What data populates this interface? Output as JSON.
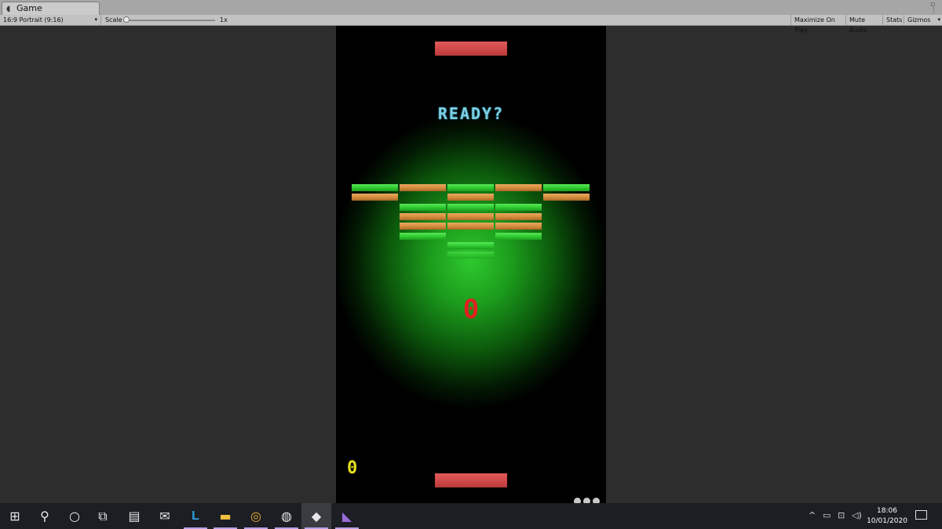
{
  "window": {
    "tab_title": "Game",
    "tab_icon": "unity-logo-icon"
  },
  "toolbar": {
    "aspect": "16:9 Portrait (9:16)",
    "scale_label": "Scale",
    "scale_value": "1x",
    "scale_slider_fraction": 0.0,
    "maximize_on_play": "Maximize On Play",
    "mute_audio": "Mute Audio",
    "stats": "Stats",
    "gizmos": "Gizmos"
  },
  "game": {
    "ready_text": "READY?",
    "center_score": "0",
    "player_score": "0",
    "colors": {
      "paddle": "#d24a4a",
      "brick_green": "#2fc82f",
      "brick_orange": "#d48c3c",
      "ready": "#7ad0e6",
      "center_score": "#e02020",
      "player_score": "#e6e020",
      "glow": "#2ec92e"
    },
    "bricks": [
      {
        "row": 0,
        "col": 0,
        "color": "green"
      },
      {
        "row": 0,
        "col": 1,
        "color": "orange"
      },
      {
        "row": 0,
        "col": 2,
        "color": "green"
      },
      {
        "row": 0,
        "col": 3,
        "color": "orange"
      },
      {
        "row": 0,
        "col": 4,
        "color": "green"
      },
      {
        "row": 1,
        "col": 0,
        "color": "orange"
      },
      {
        "row": 1,
        "col": 2,
        "color": "orange"
      },
      {
        "row": 1,
        "col": 4,
        "color": "orange"
      },
      {
        "row": 2,
        "col": 1,
        "color": "green"
      },
      {
        "row": 2,
        "col": 2,
        "color": "green"
      },
      {
        "row": 2,
        "col": 3,
        "color": "green"
      },
      {
        "row": 3,
        "col": 1,
        "color": "orange"
      },
      {
        "row": 3,
        "col": 2,
        "color": "orange"
      },
      {
        "row": 3,
        "col": 3,
        "color": "orange"
      },
      {
        "row": 4,
        "col": 1,
        "color": "orange"
      },
      {
        "row": 4,
        "col": 2,
        "color": "orange"
      },
      {
        "row": 4,
        "col": 3,
        "color": "orange"
      },
      {
        "row": 5,
        "col": 1,
        "color": "green"
      },
      {
        "row": 5,
        "col": 3,
        "color": "green"
      },
      {
        "row": 6,
        "col": 2,
        "color": "green"
      },
      {
        "row": 7,
        "col": 2,
        "color": "green",
        "faded": true
      }
    ]
  },
  "taskbar": {
    "apps": [
      {
        "name": "start-icon"
      },
      {
        "name": "search-icon"
      },
      {
        "name": "cortana-icon"
      },
      {
        "name": "task-view-icon"
      },
      {
        "name": "file-transfer-icon"
      },
      {
        "name": "mail-icon"
      },
      {
        "name": "l-app-icon",
        "glyph": "L",
        "running": true
      },
      {
        "name": "file-explorer-icon",
        "running": true
      },
      {
        "name": "chrome-icon",
        "running": true
      },
      {
        "name": "obs-icon",
        "running": true
      },
      {
        "name": "unity-icon",
        "running": true,
        "active": true
      },
      {
        "name": "visual-studio-icon",
        "running": true
      }
    ],
    "tray": [
      "chevron-up-icon",
      "battery-icon",
      "network-icon",
      "volume-icon"
    ],
    "time": "18:06",
    "date": "10/01/2020"
  }
}
